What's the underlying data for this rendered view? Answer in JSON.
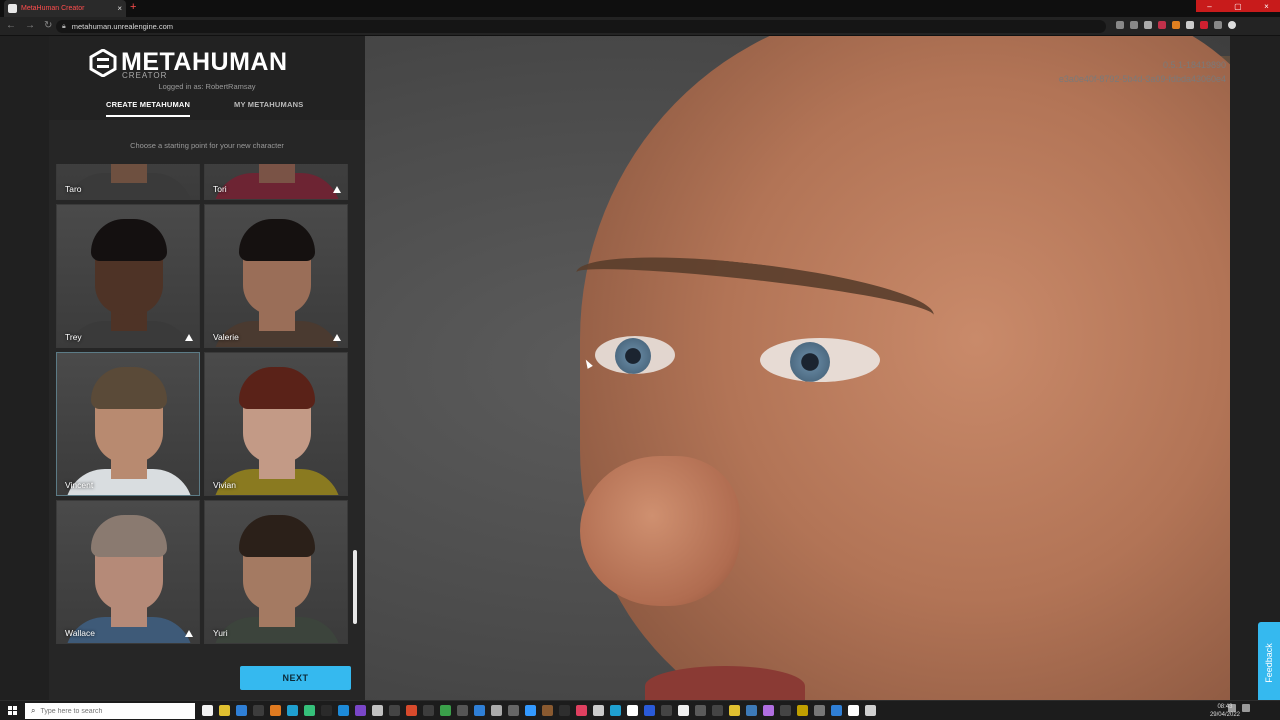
{
  "browser": {
    "tab_title": "MetaHuman Creator",
    "tab_close": "×",
    "new_tab": "+",
    "url": "metahuman.unrealengine.com",
    "window_controls": [
      "‒",
      "▢",
      "×"
    ]
  },
  "app": {
    "logo_text": "METAHUMAN",
    "logo_sub": "CREATOR",
    "logged_in": "Logged in as: RobertRamsay",
    "tabs": [
      {
        "label": "CREATE METAHUMAN",
        "active": true
      },
      {
        "label": "MY METAHUMANS",
        "active": false
      }
    ],
    "prompt": "Choose a starting point for your new character",
    "next_label": "NEXT"
  },
  "presets": [
    {
      "name": "Taro",
      "warning": false,
      "skin": "#6e5040",
      "hair": "#1d1714",
      "shirt": "#3a3a3a"
    },
    {
      "name": "Tori",
      "warning": true,
      "skin": "#7a5346",
      "hair": "#221815",
      "shirt": "#6d2433"
    },
    {
      "name": "Trey",
      "warning": true,
      "skin": "#4e3326",
      "hair": "#141010",
      "shirt": "#3a3a3a"
    },
    {
      "name": "Valerie",
      "warning": true,
      "skin": "#9a6e58",
      "hair": "#151110",
      "shirt": "#4a3a30"
    },
    {
      "name": "Vincent",
      "warning": false,
      "skin": "#b88a70",
      "hair": "#5a4a38",
      "shirt": "#d9dde0"
    },
    {
      "name": "Vivian",
      "warning": false,
      "skin": "#c39a86",
      "hair": "#5a2218",
      "shirt": "#8a7a20"
    },
    {
      "name": "Wallace",
      "warning": true,
      "skin": "#b58a78",
      "hair": "#8a7a70",
      "shirt": "#3e5a78"
    },
    {
      "name": "Yuri",
      "warning": false,
      "skin": "#a47a62",
      "hair": "#2b2019",
      "shirt": "#3c443c"
    }
  ],
  "viewport": {
    "version": "0.5.1-18419890",
    "build_id": "e3a0e40f-8792-5b4d-3a09-fdbda43060e4"
  },
  "feedback_label": "Feedback",
  "taskbar": {
    "search_placeholder": "Type here to search",
    "time": "08:43",
    "date": "29/04/2022",
    "app_colors": [
      "#f2f2f2",
      "#e0c030",
      "#2f7fd6",
      "#3c3c3c",
      "#e07a20",
      "#1fa0d0",
      "#35c07a",
      "#2a2a2a",
      "#1d8ad8",
      "#7a46c8",
      "#c0c0c0",
      "#444",
      "#d84a2c",
      "#3d3d3d",
      "#3aa04a",
      "#555",
      "#2f7fd6",
      "#aaa",
      "#666",
      "#3399ff",
      "#8a5a30",
      "#2e2e2e",
      "#e04060",
      "#cccccc",
      "#1fa0d0",
      "#fff",
      "#2a5ad8",
      "#444",
      "#f0f0f0",
      "#5a5a5a",
      "#444",
      "#e0c030",
      "#3d7ab8",
      "#b06ee0",
      "#444",
      "#c0a000",
      "#777",
      "#2f7fd6",
      "#ffffff",
      "#d0d0d0"
    ]
  }
}
